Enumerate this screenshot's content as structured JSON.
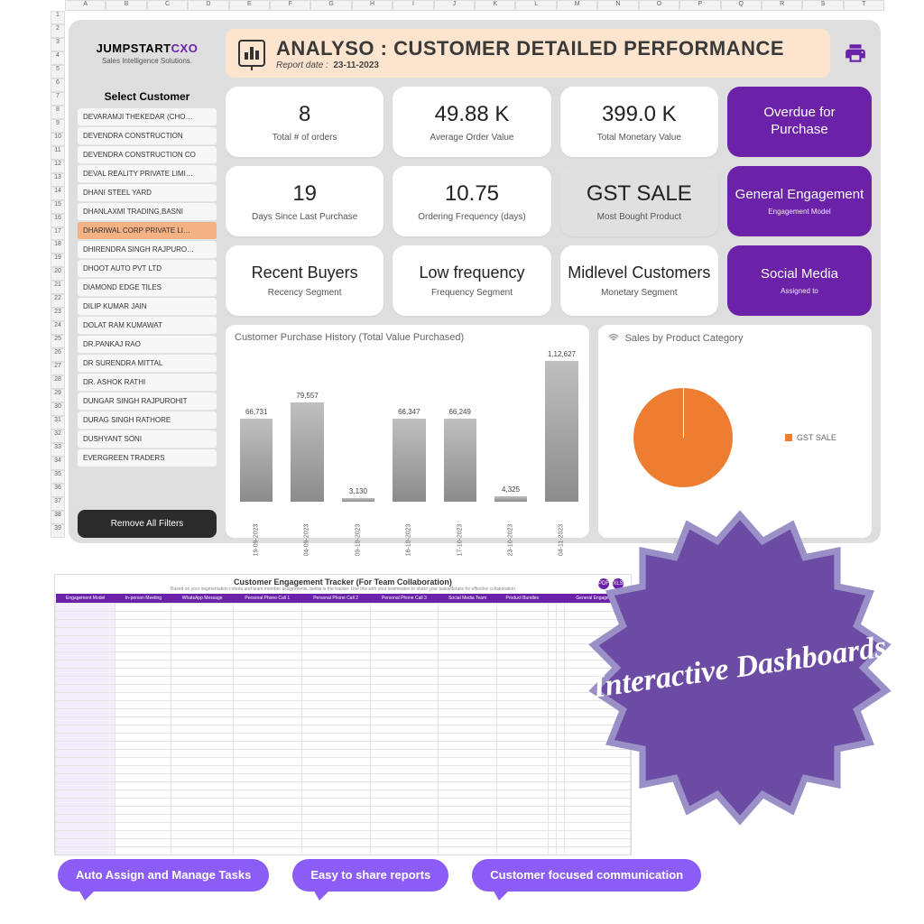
{
  "brand": {
    "part1": "JUMPSTART",
    "part2": "CXO",
    "tagline": "Sales Intelligence Solutions."
  },
  "header": {
    "title": "ANALYSO :  CUSTOMER DETAILED PERFORMANCE",
    "date_label": "Report date :",
    "date_value": "23-11-2023"
  },
  "sidebar": {
    "title": "Select Customer",
    "items": [
      "DEVARAMJI THEKEDAR (CHO…",
      "DEVENDRA CONSTRUCTION",
      "DEVENDRA CONSTRUCTION CO",
      "DEVAL REALITY PRIVATE LIMI…",
      "DHANI STEEL YARD",
      "DHANLAXMI TRADING,BASNI",
      "DHARIWAL CORP PRIVATE LI…",
      "DHIRENDRA SINGH RAJPURO…",
      "DHOOT AUTO PVT LTD",
      "DIAMOND EDGE TILES",
      "DILIP KUMAR JAIN",
      "DOLAT RAM KUMAWAT",
      "DR.PANKAJ RAO",
      "DR SURENDRA MITTAL",
      "DR. ASHOK RATHI",
      "DUNGAR SINGH RAJPUROHIT",
      "DURAG SINGH RATHORE",
      "DUSHYANT SONI",
      "EVERGREEN TRADERS"
    ],
    "selected_index": 6,
    "remove_filters": "Remove All Filters"
  },
  "kpis": [
    {
      "value": "8",
      "label": "Total # of orders"
    },
    {
      "value": "49.88 K",
      "label": "Average Order Value"
    },
    {
      "value": "399.0 K",
      "label": "Total Monetary Value"
    },
    {
      "value": "19",
      "label": "Days Since Last Purchase"
    },
    {
      "value": "10.75",
      "label": "Ordering Frequency (days)"
    },
    {
      "value": "GST SALE",
      "label": "Most Bought Product",
      "gray": true
    },
    {
      "value": "Recent Buyers",
      "label": "Recency Segment",
      "seg": true
    },
    {
      "value": "Low frequency",
      "label": "Frequency Segment",
      "seg": true
    },
    {
      "value": "Midlevel Customers",
      "label": "Monetary Segment",
      "seg": true
    }
  ],
  "ctas": [
    {
      "title": "Overdue for Purchase",
      "sub": ""
    },
    {
      "title": "General Engagement",
      "sub": "Engagement Model"
    },
    {
      "title": "Social Media",
      "sub": "Assigned to"
    }
  ],
  "chart_data": [
    {
      "type": "bar",
      "title": "Customer Purchase History (Total Value Purchased)",
      "categories": [
        "19-09-2023",
        "04-09-2023",
        "09-10-2023",
        "16-10-2023",
        "17-10-2023",
        "23-10-2023",
        "04-11-2023"
      ],
      "values": [
        66731,
        79557,
        3130,
        66347,
        66249,
        4325,
        112627
      ],
      "value_labels": [
        "66,731",
        "79,557",
        "3,130",
        "66,347",
        "66,249",
        "4,325",
        "1,12,627"
      ],
      "ylim": [
        0,
        120000
      ]
    },
    {
      "type": "pie",
      "title": "Sales by Product Category",
      "series": [
        {
          "name": "GST SALE",
          "value": 100
        }
      ]
    }
  ],
  "tracker": {
    "title": "Customer Engagement Tracker (For Team Collaboration)",
    "subtitle": "Based on your segmentation criteria and team member assignments, below is the tracker. Use this with your teammates to share your tasks/details for effective collaboration",
    "icon_labels": [
      "PDF",
      "XLS"
    ],
    "columns": [
      "Engagement Model",
      "In-person Meeting",
      "WhatsApp Message",
      "Personal Phone Call 1",
      "Personal Phone Call 2",
      "Personal Phone Call 3",
      "Social Media Team",
      "Product Bundles",
      "",
      "",
      "General Engagement"
    ]
  },
  "starburst": "Interactive Dashboards",
  "bubbles": [
    "Auto Assign and Manage Tasks",
    "Easy to share reports",
    "Customer focused communication"
  ],
  "sheet": {
    "cols": [
      "A",
      "B",
      "C",
      "D",
      "E",
      "F",
      "G",
      "H",
      "I",
      "J",
      "K",
      "L",
      "M",
      "N",
      "O",
      "P",
      "Q",
      "R",
      "S",
      "T"
    ],
    "rows": 39
  }
}
